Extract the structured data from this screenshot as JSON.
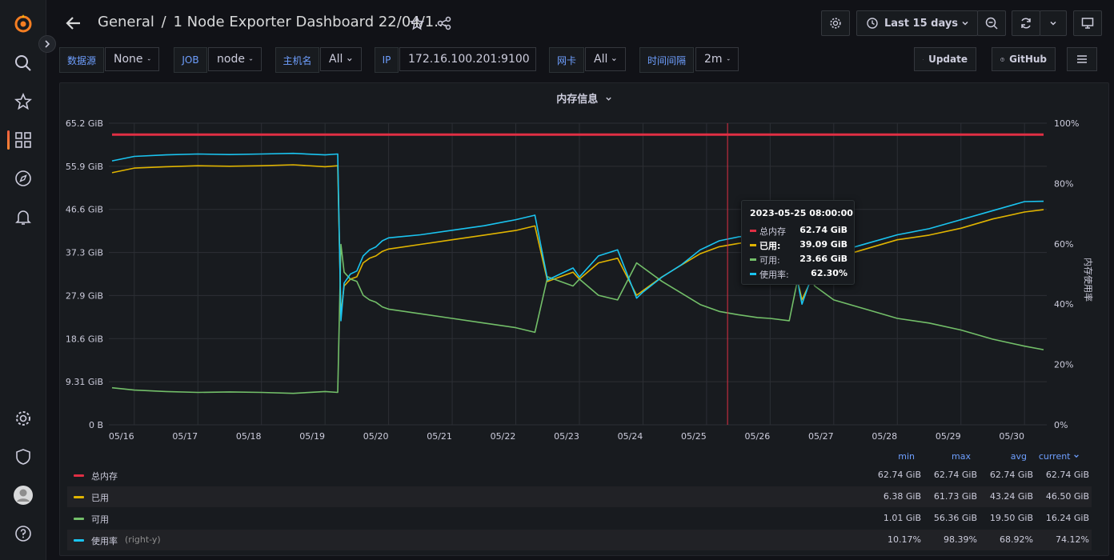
{
  "breadcrumb": {
    "folder": "General",
    "separator": "/",
    "dashboard": "1 Node Exporter Dashboard 22/04/1..."
  },
  "toolbar": {
    "time_range": "Last 15 days"
  },
  "variables": [
    {
      "label": "数据源",
      "value": "None"
    },
    {
      "label": "JOB",
      "value": "node"
    },
    {
      "label": "主机名",
      "value": "All"
    },
    {
      "label": "IP",
      "value": "172.16.100.201:9100"
    },
    {
      "label": "网卡",
      "value": "All"
    },
    {
      "label": "时间间隔",
      "value": "2m"
    }
  ],
  "links": {
    "update": "Update",
    "github": "GitHub"
  },
  "panel": {
    "title": "内存信息"
  },
  "colors": {
    "total": "#e02f44",
    "used": "#e0b400",
    "available": "#73bf69",
    "usage": "#1ac4f0",
    "accent": "#6e9fff"
  },
  "chart_data": {
    "type": "line",
    "title": "内存信息",
    "x_ticks": [
      "05/16",
      "05/17",
      "05/18",
      "05/19",
      "05/20",
      "05/21",
      "05/22",
      "05/23",
      "05/24",
      "05/25",
      "05/26",
      "05/27",
      "05/28",
      "05/29",
      "05/30"
    ],
    "y_left_ticks": [
      "0 B",
      "9.31 GiB",
      "18.6 GiB",
      "27.9 GiB",
      "37.3 GiB",
      "46.6 GiB",
      "55.9 GiB",
      "65.2 GiB"
    ],
    "y_left_max": 65.2,
    "y_right_ticks": [
      "0%",
      "20%",
      "40%",
      "60%",
      "80%",
      "100%"
    ],
    "ylabel_right": "内存使用率",
    "x_range": [
      15.6,
      30.35
    ],
    "grid": true,
    "series": [
      {
        "name": "总内存",
        "axis": "left",
        "x": [
          15.65,
          30.3
        ],
        "y": [
          62.74,
          62.74
        ]
      },
      {
        "name": "已用",
        "axis": "left",
        "x": [
          15.65,
          16.0,
          16.5,
          17.0,
          17.5,
          18.0,
          18.5,
          19.0,
          19.2,
          19.25,
          19.3,
          19.4,
          19.5,
          19.6,
          19.7,
          19.8,
          19.9,
          20.0,
          20.5,
          21.0,
          21.5,
          22.0,
          22.3,
          22.5,
          22.7,
          22.9,
          23.0,
          23.3,
          23.6,
          23.9,
          24.0,
          24.3,
          24.6,
          24.9,
          25.2,
          25.5,
          25.8,
          26.0,
          26.3,
          26.5,
          26.7,
          27.0,
          27.5,
          28.0,
          28.5,
          29.0,
          29.5,
          30.0,
          30.3
        ],
        "y": [
          54.5,
          55.5,
          55.8,
          56.0,
          55.9,
          56.0,
          56.2,
          55.8,
          56.0,
          24.0,
          30.0,
          31.5,
          32.0,
          35.0,
          36.0,
          36.5,
          37.5,
          38.0,
          39.0,
          40.0,
          41.0,
          42.0,
          43.0,
          31.0,
          32.0,
          33.0,
          31.5,
          35.0,
          36.0,
          28.0,
          29.0,
          32.0,
          34.5,
          37.0,
          38.5,
          39.2,
          39.8,
          40.0,
          39.5,
          27.0,
          33.0,
          36.0,
          38.0,
          40.0,
          41.0,
          42.5,
          44.5,
          46.0,
          46.5
        ]
      },
      {
        "name": "可用",
        "axis": "left",
        "x": [
          15.65,
          16.0,
          16.5,
          17.0,
          17.5,
          18.0,
          18.5,
          19.0,
          19.2,
          19.25,
          19.3,
          19.4,
          19.5,
          19.6,
          19.7,
          19.8,
          19.9,
          20.0,
          20.5,
          21.0,
          21.5,
          22.0,
          22.3,
          22.5,
          22.7,
          22.9,
          23.0,
          23.3,
          23.6,
          23.9,
          24.0,
          24.3,
          24.6,
          24.9,
          25.2,
          25.5,
          25.8,
          26.0,
          26.3,
          26.5,
          26.7,
          27.0,
          27.5,
          28.0,
          28.5,
          29.0,
          29.5,
          30.0,
          30.3
        ],
        "y": [
          8.0,
          7.5,
          7.2,
          7.0,
          7.1,
          7.0,
          6.8,
          7.2,
          7.0,
          39.0,
          33.0,
          31.5,
          31.0,
          28.0,
          27.0,
          26.5,
          25.5,
          25.0,
          24.0,
          23.0,
          22.0,
          21.0,
          20.0,
          32.0,
          31.0,
          30.0,
          31.5,
          28.0,
          27.0,
          35.0,
          34.0,
          31.0,
          28.5,
          26.0,
          24.5,
          23.8,
          23.2,
          23.0,
          22.5,
          36.0,
          30.0,
          27.0,
          25.0,
          23.0,
          22.0,
          20.5,
          18.5,
          17.0,
          16.24
        ]
      },
      {
        "name": "使用率",
        "axis": "right",
        "unit": "%",
        "x": [
          15.65,
          16.0,
          16.5,
          17.0,
          17.5,
          18.0,
          18.5,
          19.0,
          19.2,
          19.25,
          19.3,
          19.4,
          19.5,
          19.6,
          19.7,
          19.8,
          19.9,
          20.0,
          20.5,
          21.0,
          21.5,
          22.0,
          22.3,
          22.5,
          22.7,
          22.9,
          23.0,
          23.3,
          23.6,
          23.9,
          24.0,
          24.3,
          24.6,
          24.9,
          25.2,
          25.5,
          25.8,
          26.0,
          26.3,
          26.5,
          26.7,
          27.0,
          27.5,
          28.0,
          28.5,
          29.0,
          29.5,
          30.0,
          30.3
        ],
        "y": [
          87.5,
          89.0,
          89.5,
          89.8,
          89.6,
          89.8,
          90.0,
          89.5,
          89.8,
          34.5,
          47.0,
          50.0,
          51.0,
          56.0,
          58.0,
          59.0,
          61.0,
          62.0,
          63.0,
          64.5,
          66.0,
          68.0,
          69.5,
          48.0,
          50.0,
          52.0,
          49.0,
          56.0,
          58.0,
          42.0,
          44.0,
          49.0,
          53.0,
          58.0,
          61.0,
          62.3,
          63.0,
          63.5,
          62.0,
          40.0,
          52.0,
          57.0,
          60.0,
          63.0,
          65.0,
          68.0,
          71.0,
          74.0,
          74.12
        ]
      }
    ],
    "tooltip": {
      "time": "2023-05-25 08:00:00",
      "x": 25.33,
      "items": [
        {
          "name": "总内存",
          "value": "62.74 GiB"
        },
        {
          "name": "已用:",
          "value": "39.09 GiB"
        },
        {
          "name": "可用:",
          "value": "23.66 GiB"
        },
        {
          "name": "使用率:",
          "value": "62.30%"
        }
      ]
    },
    "legend": {
      "columns": [
        "min",
        "max",
        "avg",
        "current"
      ],
      "rows": [
        {
          "name": "总内存",
          "suffix": "",
          "values": [
            "62.74 GiB",
            "62.74 GiB",
            "62.74 GiB",
            "62.74 GiB"
          ]
        },
        {
          "name": "已用",
          "suffix": "",
          "values": [
            "6.38 GiB",
            "61.73 GiB",
            "43.24 GiB",
            "46.50 GiB"
          ]
        },
        {
          "name": "可用",
          "suffix": "",
          "values": [
            "1.01 GiB",
            "56.36 GiB",
            "19.50 GiB",
            "16.24 GiB"
          ]
        },
        {
          "name": "使用率",
          "suffix": "(right-y)",
          "values": [
            "10.17%",
            "98.39%",
            "68.92%",
            "74.12%"
          ]
        }
      ]
    }
  }
}
